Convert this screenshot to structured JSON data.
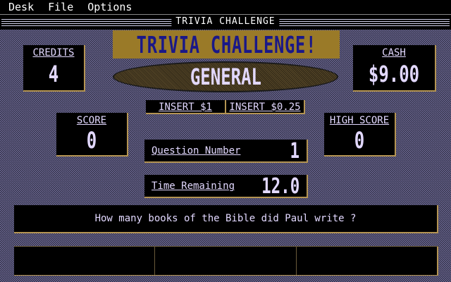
{
  "menubar": {
    "items": [
      "Desk",
      "File",
      "Options"
    ]
  },
  "window": {
    "title": "TRIVIA CHALLENGE"
  },
  "banner": {
    "title": "TRIVIA CHALLENGE!"
  },
  "category": {
    "name": "GENERAL"
  },
  "credits": {
    "label": "CREDITS",
    "value": "4"
  },
  "cash": {
    "label": "CASH",
    "value": "$9.00"
  },
  "insert": {
    "dollar_label": "INSERT $1",
    "quarter_label": "INSERT $0.25"
  },
  "score": {
    "label": "SCORE",
    "value": "0"
  },
  "high_score": {
    "label": "HIGH SCORE",
    "value": "0"
  },
  "question_number": {
    "label": "Question Number",
    "value": "1"
  },
  "time_remaining": {
    "label": "Time Remaining",
    "value": "12.0"
  },
  "question": {
    "text": "How many books of the Bible did Paul write ?"
  },
  "answers": [
    "",
    "",
    ""
  ],
  "colors": {
    "banner_bg": "#9a7a28",
    "banner_text": "#1a1888",
    "box_shadow": "#b49452",
    "text": "#e2d8ff"
  }
}
